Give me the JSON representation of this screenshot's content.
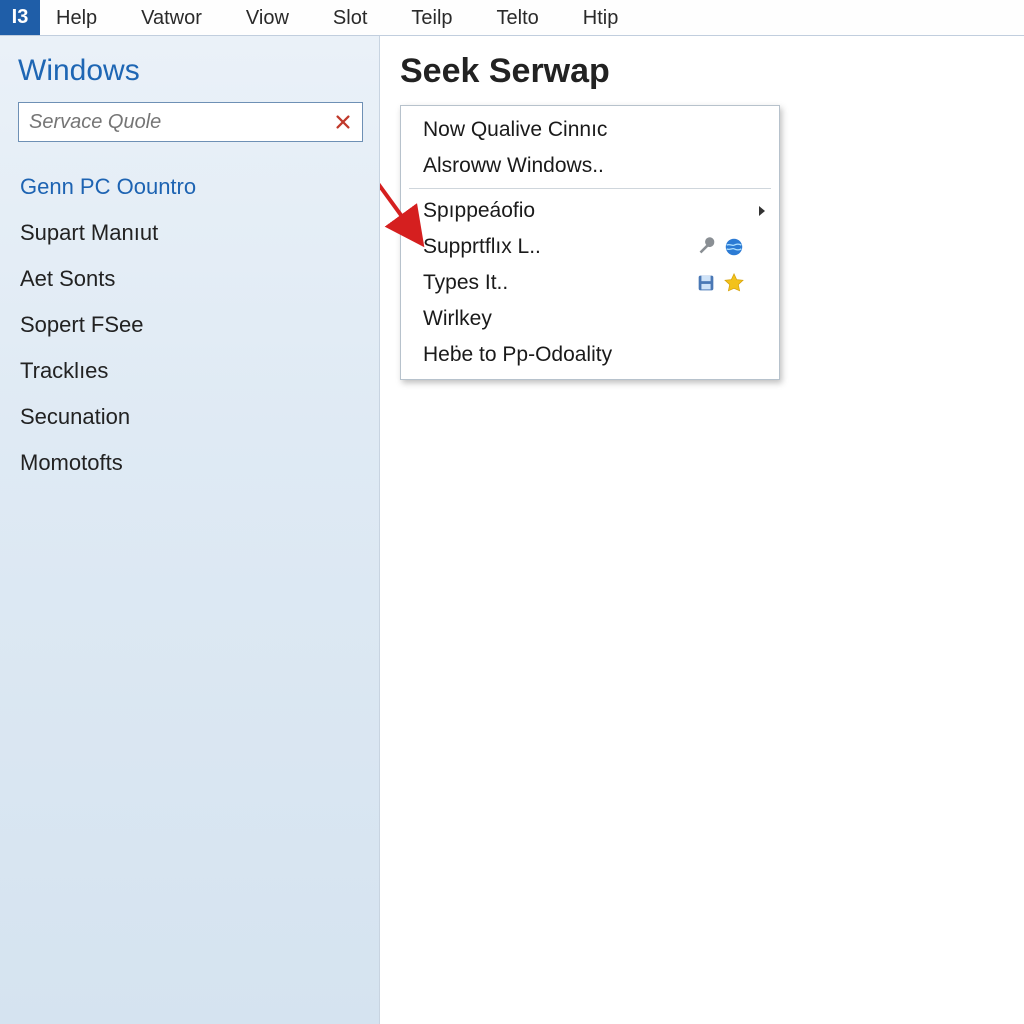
{
  "app_icon_text": "I3",
  "menubar": {
    "items": [
      "Help",
      "Vatwor",
      "Viow",
      "Slot",
      "Teilp",
      "Telto",
      "Htip"
    ]
  },
  "sidebar": {
    "title": "Windows",
    "search": {
      "placeholder": "Servace Quole"
    },
    "items": [
      {
        "label": "Genn PC Oountro",
        "active": true
      },
      {
        "label": "Supart Manıut"
      },
      {
        "label": "Aet Sonts"
      },
      {
        "label": "Sopert FSee"
      },
      {
        "label": "Tracklıes"
      },
      {
        "label": "Secunation"
      },
      {
        "label": "Momotofts"
      }
    ]
  },
  "main": {
    "title": "Seek Serwap",
    "context_menu": {
      "group1": [
        {
          "label": "Now Qualive Cinnıc"
        },
        {
          "label": "Alsroww Windows.."
        }
      ],
      "group2": [
        {
          "label": "Spıppeáofio",
          "submenu": true
        },
        {
          "label": "Supprtflıx L..",
          "icons": [
            "wrench",
            "globe"
          ]
        },
        {
          "label": "Types It..",
          "icons": [
            "disk",
            "star"
          ]
        },
        {
          "label": "Wirlkey"
        },
        {
          "label": "Heḃe to Pp-Odoality"
        }
      ]
    }
  },
  "colors": {
    "accent_blue": "#1e66b4",
    "arrow_red": "#d51f1f"
  }
}
